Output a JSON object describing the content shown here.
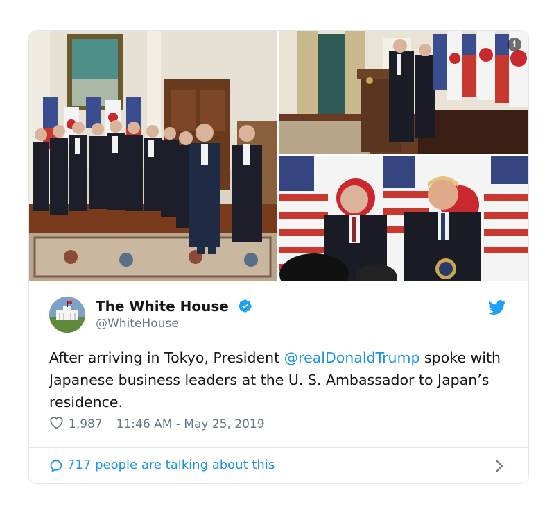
{
  "tweet": {
    "display_name": "The White House",
    "handle": "@WhiteHouse",
    "text_before": "After arriving in Tokyo, President ",
    "mention": "@realDonaldTrump",
    "text_after": " spoke with Japanese business leaders at the U. S. Ambassador to Japan’s residence.",
    "likes": "1,987",
    "timestamp": "11:46 AM - May 25, 2019",
    "talking": "717 people are talking about this",
    "info_glyph": "i"
  },
  "icons": {
    "verified": "verified-badge-icon",
    "twitter": "twitter-bird-icon",
    "heart": "heart-icon",
    "reply": "speech-bubble-icon",
    "chevron": "chevron-right-icon",
    "info": "info-icon"
  },
  "colors": {
    "accent": "#1b95e0",
    "verified": "#1da1f2",
    "secondary_text": "#657786",
    "border": "#e1e8ed"
  }
}
